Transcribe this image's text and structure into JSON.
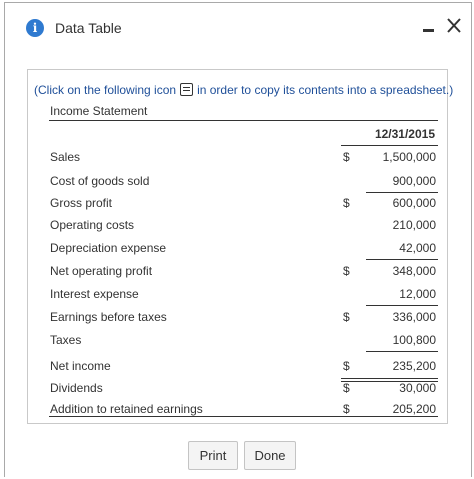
{
  "window": {
    "title": "Data Table",
    "minimize_label": "-",
    "close_label": "X"
  },
  "instructions": {
    "before_icon": "(Click on the following icon",
    "after_icon": "in order to copy its contents into a spreadsheet.)"
  },
  "statement": {
    "title": "Income Statement",
    "column_header": "12/31/2015",
    "rows": [
      {
        "label": "Sales",
        "currency": "$",
        "value": "1,500,000"
      },
      {
        "label": "Cost of goods sold",
        "currency": "",
        "value": "900,000"
      },
      {
        "label": "Gross profit",
        "currency": "$",
        "value": "600,000"
      },
      {
        "label": "Operating costs",
        "currency": "",
        "value": "210,000"
      },
      {
        "label": "Depreciation expense",
        "currency": "",
        "value": "42,000"
      },
      {
        "label": "Net operating profit",
        "currency": "$",
        "value": "348,000"
      },
      {
        "label": "Interest expense",
        "currency": "",
        "value": "12,000"
      },
      {
        "label": "Earnings before taxes",
        "currency": "$",
        "value": "336,000"
      },
      {
        "label": "Taxes",
        "currency": "",
        "value": "100,800"
      },
      {
        "label": "Net income",
        "currency": "$",
        "value": "235,200"
      },
      {
        "label": "Dividends",
        "currency": "$",
        "value": "30,000"
      },
      {
        "label": "Addition to retained earnings",
        "currency": "$",
        "value": "205,200"
      }
    ]
  },
  "buttons": {
    "print": "Print",
    "done": "Done"
  },
  "colors": {
    "info_icon": "#2f7ad0",
    "instruction_text": "#1f4f99",
    "text": "#333333"
  }
}
